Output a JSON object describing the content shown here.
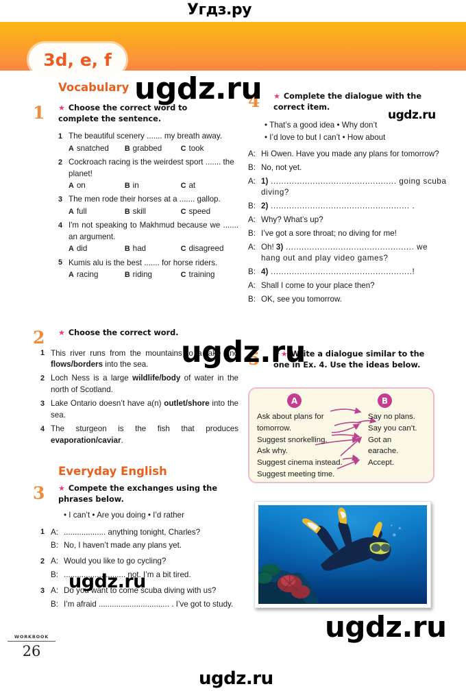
{
  "page": {
    "unit_label": "3d, e, f",
    "footer_label": "WORKBOOK",
    "page_number": "26",
    "accent_orange": "#e8601c",
    "number_orange": "#f08b3a",
    "star_pink": "#ee3d6a",
    "magenta": "#c63a8f"
  },
  "watermarks": {
    "top": "Угдз.ру",
    "big1": "ugdz.ru",
    "small1": "ugdz.ru",
    "big2": "ugdz.ru",
    "mid": "ugdz.ru",
    "big3": "ugdz.ru",
    "bottom": "ugdz.ru"
  },
  "sections": {
    "vocabulary": "Vocabulary",
    "everyday_english": "Everyday English"
  },
  "ex1": {
    "number": "1",
    "stars": "★",
    "rubric": "Choose the correct word to complete the sentence.",
    "items": [
      {
        "n": "1",
        "text": "The beautiful scenery ....... my breath away.",
        "options": [
          {
            "letter": "A",
            "word": "snatched"
          },
          {
            "letter": "B",
            "word": "grabbed"
          },
          {
            "letter": "C",
            "word": "took"
          }
        ]
      },
      {
        "n": "2",
        "text": "Cockroach racing is the weirdest sport ....... the planet!",
        "options": [
          {
            "letter": "A",
            "word": "on"
          },
          {
            "letter": "B",
            "word": "in"
          },
          {
            "letter": "C",
            "word": "at"
          }
        ]
      },
      {
        "n": "3",
        "text": "The men rode their horses at a ....... gallop.",
        "options": [
          {
            "letter": "A",
            "word": "full"
          },
          {
            "letter": "B",
            "word": "skill"
          },
          {
            "letter": "C",
            "word": "speed"
          }
        ]
      },
      {
        "n": "4",
        "text": "I'm not speaking to Makhmud because we ....... an argument.",
        "options": [
          {
            "letter": "A",
            "word": "did"
          },
          {
            "letter": "B",
            "word": "had"
          },
          {
            "letter": "C",
            "word": "disagreed"
          }
        ]
      },
      {
        "n": "5",
        "text": "Kumis alu is the best ....... for horse riders.",
        "options": [
          {
            "letter": "A",
            "word": "racing"
          },
          {
            "letter": "B",
            "word": "riding"
          },
          {
            "letter": "C",
            "word": "training"
          }
        ]
      }
    ]
  },
  "ex2": {
    "number": "2",
    "stars": "★",
    "rubric": "Choose the correct word.",
    "items": [
      {
        "n": "1",
        "pre": "This river runs from the mountains to a lake and ",
        "bold": "flows/borders",
        "post": " into the sea."
      },
      {
        "n": "2",
        "pre": "Loch Ness is a large ",
        "bold": "wildlife/body",
        "post": " of water in the north of Scotland."
      },
      {
        "n": "3",
        "pre": "Lake Ontario doesn’t have a(n) ",
        "bold": "outlet/shore",
        "post": " into the sea."
      },
      {
        "n": "4",
        "pre": "The sturgeon is the fish that produces ",
        "bold": "evaporation/caviar",
        "post": "."
      }
    ]
  },
  "ex3": {
    "number": "3",
    "stars": "★",
    "rubric": "Compete the exchanges using the phrases below.",
    "phrases": "• I can’t  • Are you doing  • I’d rather",
    "exchanges": [
      {
        "n": "1",
        "lines": [
          {
            "speaker": "A:",
            "text": "...................  anything tonight, Charles?"
          },
          {
            "speaker": "B:",
            "text": "No, I haven’t made any plans yet."
          }
        ]
      },
      {
        "n": "2",
        "lines": [
          {
            "speaker": "A:",
            "text": "Would you like to go cycling?"
          },
          {
            "speaker": "B:",
            "text": "............................ not. I’m a bit tired."
          }
        ]
      },
      {
        "n": "3",
        "lines": [
          {
            "speaker": "A:",
            "text": "Do you want to come scuba diving with us?"
          },
          {
            "speaker": "B:",
            "text": "I’m afraid ................................ . I’ve got to study."
          }
        ]
      }
    ]
  },
  "ex4": {
    "number": "4",
    "stars": "★",
    "rubric": "Complete the dialogue with the correct item.",
    "phrases_line1": "• That’s a good idea  • Why don’t",
    "phrases_line2": "• I’d love to but I can’t  • How about",
    "dialogue": [
      {
        "speaker": "A:",
        "text": "Hi Owen. Have you made any plans for tomorrow?"
      },
      {
        "speaker": "B:",
        "text": "No, not yet."
      },
      {
        "speaker": "A:",
        "num": "1)",
        "text": " ................................................  going scuba diving?"
      },
      {
        "speaker": "B:",
        "num": "2)",
        "text": " ..................................................... ."
      },
      {
        "speaker": "A:",
        "text": "Why? What’s up?"
      },
      {
        "speaker": "B:",
        "text": "I’ve got a sore throat; no diving for me!"
      },
      {
        "speaker": "A:",
        "num": "3)",
        "prefix": "Oh! ",
        "text": " .................................................  we hang out and play video games?"
      },
      {
        "speaker": "B:",
        "num": "4)",
        "text": " ......................................................!"
      },
      {
        "speaker": "A:",
        "text": "Shall I come to your place then?"
      },
      {
        "speaker": "B:",
        "text": "OK, see you tomorrow."
      }
    ]
  },
  "ex5": {
    "number": "5",
    "stars": "★★",
    "rubric": "Write a dialogue similar to the one in Ex. 4. Use the ideas below.",
    "idea_box": {
      "col_a_label": "A",
      "col_b_label": "B",
      "col_a": [
        "Ask about plans for",
        "tomorrow.",
        "Suggest snorkelling.",
        "Ask why.",
        "Suggest cinema instead.",
        "Suggest meeting time."
      ],
      "col_b": [
        "Say no plans.",
        "Say you can’t.",
        "Got an",
        "earache.",
        "Accept.",
        ""
      ]
    }
  },
  "photo": {
    "alt": "scuba-diver-underwater-photo"
  }
}
